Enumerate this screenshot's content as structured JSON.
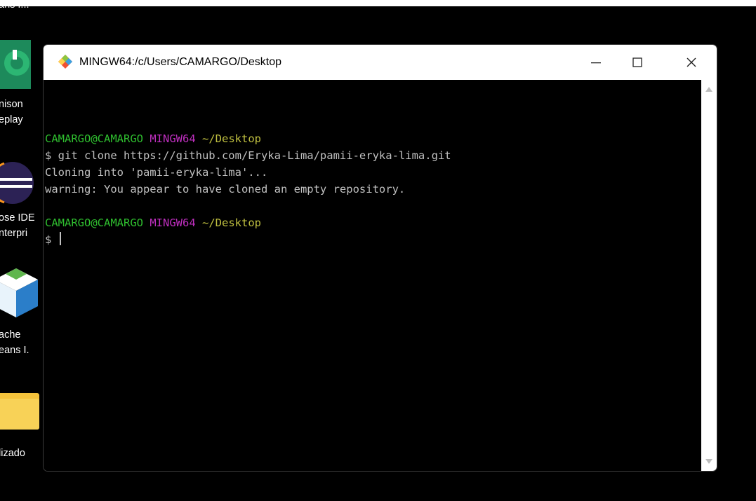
{
  "desktop": {
    "items": [
      {
        "label_lines": [
          "ans I..."
        ]
      },
      {
        "label_lines": [
          "nison",
          "eplay"
        ]
      },
      {
        "label_lines": [
          "ose IDE",
          "nterpri"
        ]
      },
      {
        "label_lines": [
          "ache",
          "eans I."
        ]
      },
      {
        "label_lines": [
          "lizado"
        ]
      }
    ]
  },
  "window": {
    "title": "MINGW64:/c/Users/CAMARGO/Desktop",
    "controls": {
      "minimize": "—",
      "maximize": "☐",
      "close": "✕"
    }
  },
  "terminal": {
    "prompt1": {
      "user": "CAMARGO@CAMARGO",
      "env": "MINGW64",
      "path": "~/Desktop"
    },
    "cmd1": "$ git clone https://github.com/Eryka-Lima/pamii-eryka-lima.git",
    "out1": "Cloning into 'pamii-eryka-lima'...",
    "out2": "warning: You appear to have cloned an empty repository.",
    "prompt2": {
      "user": "CAMARGO@CAMARGO",
      "env": "MINGW64",
      "path": "~/Desktop"
    },
    "input_prompt": "$"
  },
  "colors": {
    "user": "#2fbf2f",
    "env": "#bf2fbf",
    "path": "#c0c040",
    "text": "#c0c0c0",
    "background": "#000000"
  }
}
